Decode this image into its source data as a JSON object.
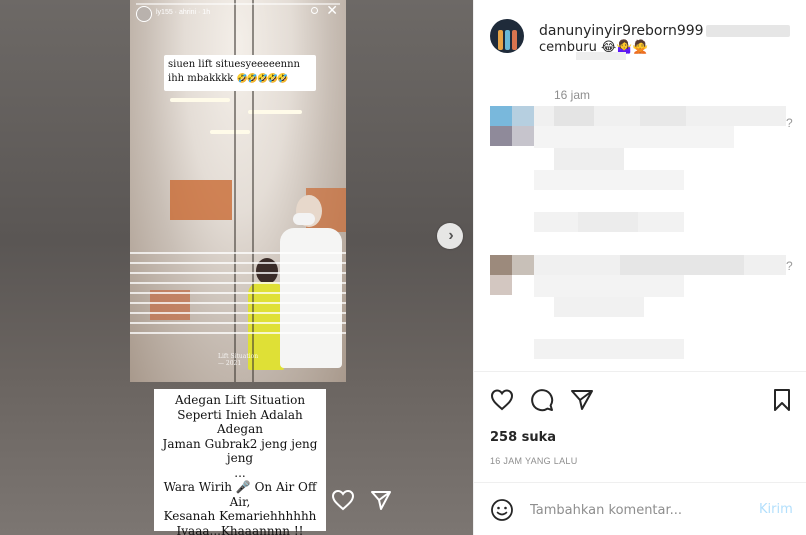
{
  "story": {
    "username": "ly155 · ahrini · 1h",
    "caption_top_line1": "siuen lift situesyeeeeennn",
    "caption_top_line2": "ihh mbakkkk",
    "caption_top_emoji": "🤣🤣🤣🤣🤣",
    "watermark_line1": "Lift Situation",
    "watermark_line2": "— 2021"
  },
  "overlay_caption": {
    "lines": [
      "Adegan Lift Situation",
      "Seperti Inieh Adalah Adegan",
      "Jaman Gubrak2 jeng jeng",
      "jeng",
      "...",
      "Wara Wirih 🎤 On Air Off",
      "Air,",
      "Kesanah Kemariehhhhhh",
      "Iyaaa...Khaaannnn !!"
    ]
  },
  "post": {
    "username": "danunyinyir9reborn999",
    "caption": "cemburu 😂🤷‍♀️🙅",
    "time": "16 jam"
  },
  "actions": {
    "likes": "258 suka",
    "posted_ago": "16 JAM YANG LALU"
  },
  "comment_box": {
    "placeholder": "Tambahkan komentar...",
    "send_label": "Kirim"
  },
  "icons": {
    "like": "heart-icon",
    "comment": "comment-bubble-icon",
    "share": "paper-plane-icon",
    "save": "bookmark-icon",
    "emoji": "smiley-icon",
    "next": "chevron-right-icon",
    "close": "close-icon"
  },
  "colors": {
    "send_disabled": "#b2dffc",
    "muted_text": "#8e8e8e",
    "primary_text": "#262626"
  }
}
